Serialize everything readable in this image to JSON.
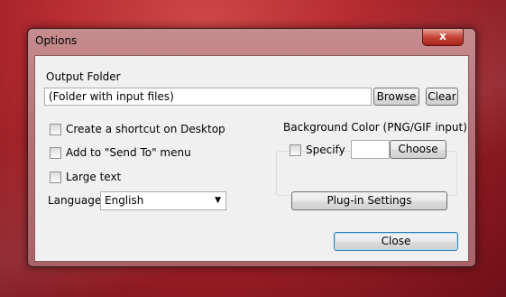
{
  "window": {
    "title": "Options",
    "close_glyph": "x"
  },
  "output_folder": {
    "label": "Output Folder",
    "value": "(Folder with input files)",
    "browse_label": "Browse",
    "clear_label": "Clear"
  },
  "options": {
    "shortcut_label": "Create a shortcut on Desktop",
    "shortcut_checked": false,
    "sendto_label": "Add to \"Send To\" menu",
    "sendto_checked": false,
    "largetext_label": "Large text",
    "largetext_checked": false
  },
  "background_color": {
    "group_label": "Background Color (PNG/GIF input)",
    "specify_label": "Specify",
    "specify_checked": false,
    "color_value": "",
    "choose_label": "Choose"
  },
  "language": {
    "label": "Language",
    "selected": "English"
  },
  "plugin_button_label": "Plug-in Settings",
  "close_button_label": "Close",
  "icons": {
    "close": "close-icon",
    "dropdown": "chevron-down-icon"
  }
}
